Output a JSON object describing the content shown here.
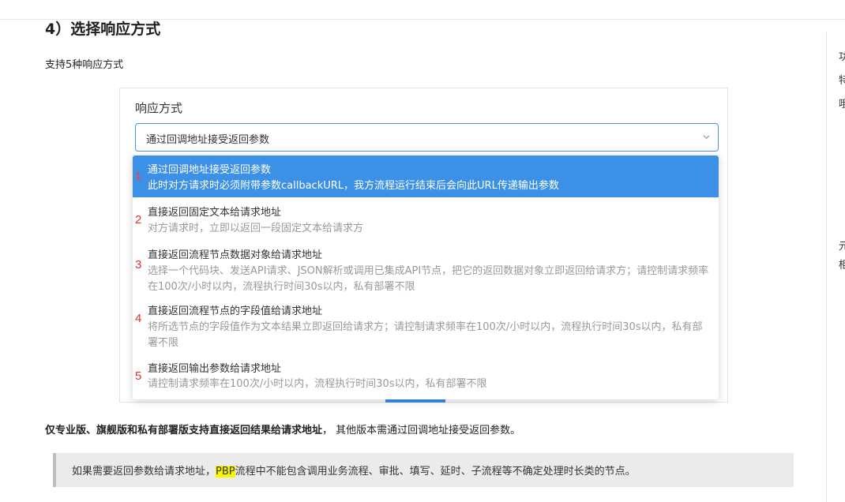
{
  "section": {
    "title": "4）选择响应方式",
    "intro": "支持5种响应方式"
  },
  "panel": {
    "title": "响应方式",
    "selected": "通过回调地址接受返回参数",
    "options": [
      {
        "num": "1",
        "title": "通过回调地址接受返回参数",
        "desc": "此时对方请求时必须附带参数callbackURL，我方流程运行结束后会向此URL传递输出参数"
      },
      {
        "num": "2",
        "title": "直接返回固定文本给请求地址",
        "desc": "对方请求时，立即以返回一段固定文本给请求方"
      },
      {
        "num": "3",
        "title": "直接返回流程节点数据对象给请求地址",
        "desc": "选择一个代码块、发送API请求、JSON解析或调用已集成API节点，把它的返回数据对象立即返回给请求方；请控制请求频率在100次/小时以内，流程执行时间30s以内，私有部署不限"
      },
      {
        "num": "4",
        "title": "直接返回流程节点的字段值给请求地址",
        "desc": "将所选节点的字段值作为文本结果立即返回给请求方；请控制请求频率在100次/小时以内，流程执行时间30s以内，私有部署不限"
      },
      {
        "num": "5",
        "title": "直接返回输出参数给请求地址",
        "desc": "请控制请求频率在100次/小时以内，流程执行时间30s以内，私有部署不限"
      }
    ]
  },
  "notice": {
    "bold": "仅专业版、旗舰版和私有部署版支持直接返回结果给请求地址",
    "rest": "， 其他版本需通过回调地址接受返回参数。"
  },
  "tip": {
    "before": "如果需要返回参数给请求地址，",
    "highlight": "PBP",
    "after": "流程中不能包含调用业务流程、审批、填写、延时、子流程等不确定处理时长类的节点。"
  },
  "right_rail": [
    "功",
    "特",
    "哦",
    "元",
    "柜"
  ],
  "colors": {
    "accent": "#3c91e6",
    "marker": "#e03131",
    "highlight": "#f7f700"
  }
}
